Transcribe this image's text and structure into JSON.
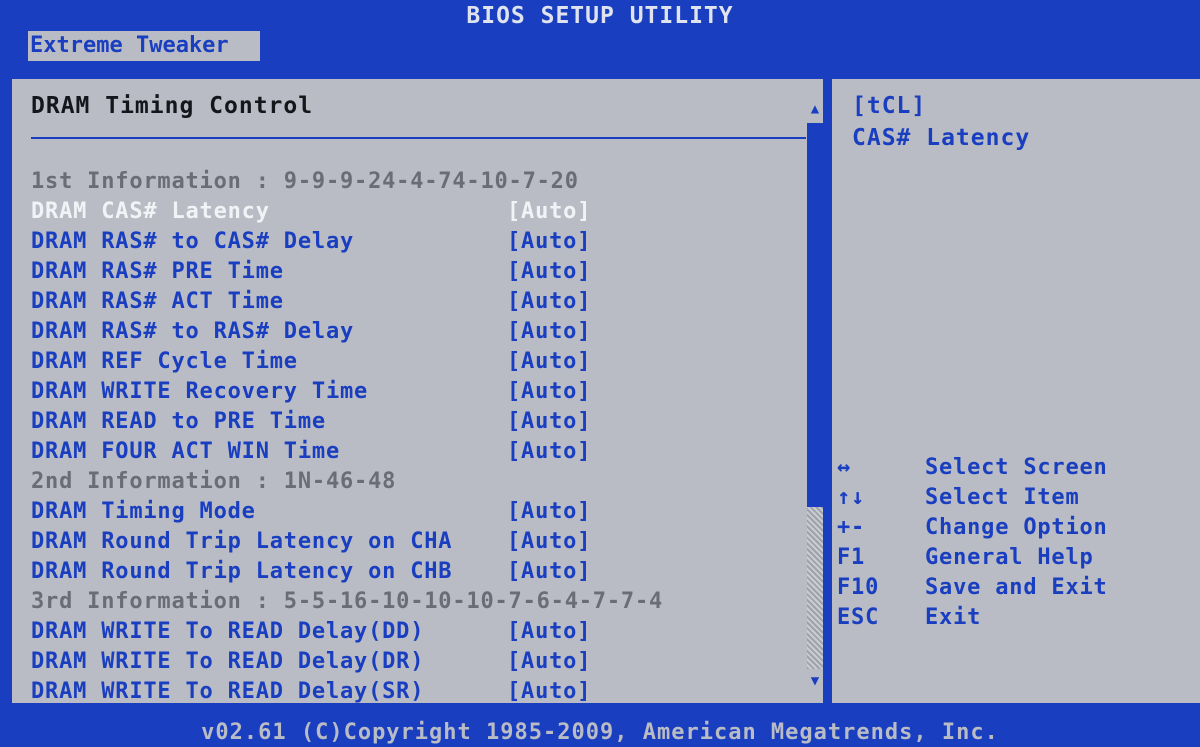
{
  "header": {
    "title": "BIOS SETUP UTILITY"
  },
  "menu": {
    "active_tab": "Extreme Tweaker"
  },
  "main": {
    "panel_title": "DRAM Timing Control",
    "rows": [
      {
        "type": "info",
        "text": "1st Information : 9-9-9-24-4-74-10-7-20"
      },
      {
        "type": "setting",
        "label": "DRAM CAS# Latency",
        "value": "[Auto]",
        "selected": true
      },
      {
        "type": "setting",
        "label": "DRAM RAS# to CAS# Delay",
        "value": "[Auto]"
      },
      {
        "type": "setting",
        "label": "DRAM RAS# PRE Time",
        "value": "[Auto]"
      },
      {
        "type": "setting",
        "label": "DRAM RAS# ACT Time",
        "value": "[Auto]"
      },
      {
        "type": "setting",
        "label": "DRAM RAS# to RAS# Delay",
        "value": "[Auto]"
      },
      {
        "type": "setting",
        "label": "DRAM REF Cycle Time",
        "value": "[Auto]"
      },
      {
        "type": "setting",
        "label": "DRAM WRITE Recovery Time",
        "value": "[Auto]"
      },
      {
        "type": "setting",
        "label": "DRAM READ to PRE Time",
        "value": "[Auto]"
      },
      {
        "type": "setting",
        "label": "DRAM FOUR ACT WIN Time",
        "value": "[Auto]"
      },
      {
        "type": "info",
        "text": "2nd Information : 1N-46-48"
      },
      {
        "type": "setting",
        "label": "DRAM Timing Mode",
        "value": "[Auto]"
      },
      {
        "type": "setting",
        "label": "DRAM Round Trip Latency on CHA",
        "value": "[Auto]"
      },
      {
        "type": "setting",
        "label": "DRAM Round Trip Latency on CHB",
        "value": "[Auto]"
      },
      {
        "type": "info",
        "text": "3rd Information : 5-5-16-10-10-10-7-6-4-7-7-4"
      },
      {
        "type": "setting",
        "label": "DRAM WRITE To READ Delay(DD)",
        "value": "[Auto]"
      },
      {
        "type": "setting",
        "label": "DRAM WRITE To READ Delay(DR)",
        "value": "[Auto]"
      },
      {
        "type": "setting",
        "label": "DRAM WRITE To READ Delay(SR)",
        "value": "[Auto]"
      }
    ]
  },
  "scroll": {
    "up_glyph": "▲",
    "down_glyph": "▼"
  },
  "help": {
    "key": "[tCL]",
    "text": "CAS# Latency",
    "keys": [
      {
        "key": "↔",
        "desc": "Select Screen"
      },
      {
        "key": "↑↓",
        "desc": "Select Item"
      },
      {
        "key": "+-",
        "desc": "Change Option"
      },
      {
        "key": "F1",
        "desc": "General Help"
      },
      {
        "key": "F10",
        "desc": "Save and Exit"
      },
      {
        "key": "ESC",
        "desc": "Exit"
      }
    ]
  },
  "footer": {
    "text": "v02.61 (C)Copyright 1985-2009, American Megatrends, Inc."
  },
  "colors": {
    "bios_blue": "#1a3ec0",
    "panel_gray": "#b9bcc4",
    "selected_text": "#f2f3f6",
    "info_text": "#6a6d78"
  }
}
